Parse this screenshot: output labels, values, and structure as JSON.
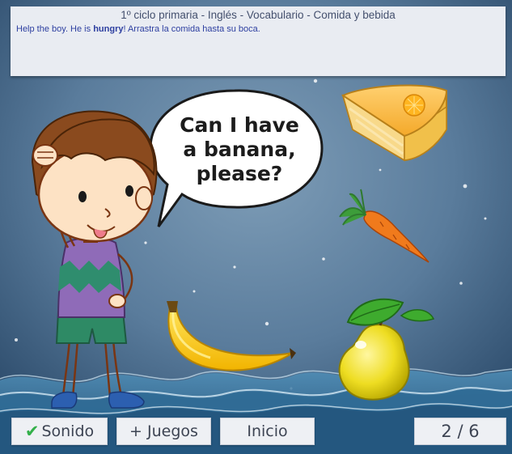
{
  "header": {
    "title": "1º ciclo primaria - Inglés - Vocabulario - Comida y bebida",
    "instruction_before": "Help the boy. He is ",
    "instruction_bold": "hungry",
    "instruction_after": "! Arrastra la comida hasta su boca."
  },
  "speech": {
    "line1": "Can I have",
    "line2": "a banana,",
    "line3": "please?"
  },
  "foods": [
    {
      "name": "cake",
      "kind": "cheesecake slice"
    },
    {
      "name": "carrot",
      "kind": "carrot"
    },
    {
      "name": "banana",
      "kind": "banana"
    },
    {
      "name": "pear",
      "kind": "pear"
    }
  ],
  "footer": {
    "sound_icon": "check-icon",
    "sound_label": "Sonido",
    "more_games_label": "+ Juegos",
    "home_label": "Inicio",
    "progress": "2 / 6"
  },
  "colors": {
    "background_top": "#6d8eaa",
    "background_bottom": "#2e4f70",
    "header_bg": "#e9ecf2",
    "title_text": "#44506e",
    "instruction_text": "#2d3fa0",
    "button_bg": "#eef0f4",
    "check_green": "#33b04a"
  }
}
